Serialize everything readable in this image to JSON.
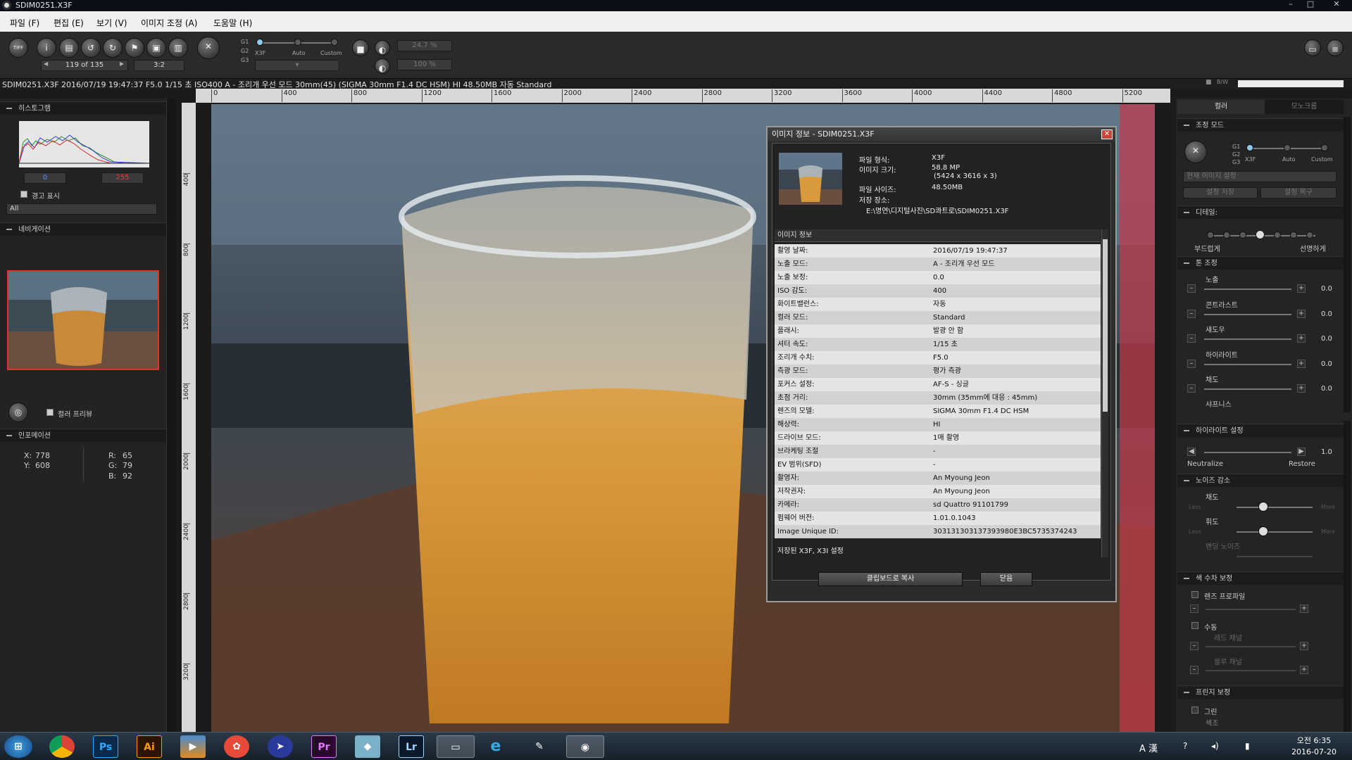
{
  "window": {
    "title": "SDIM0251.X3F",
    "minimize": "–",
    "maximize": "□",
    "close": "✕"
  },
  "menu": [
    "파일 (F)",
    "편집 (E)",
    "보기 (V)",
    "이미지 조정 (A)",
    "도움말 (H)"
  ],
  "toolbar": {
    "save_tiff_label": "TIFF",
    "frame_counter": "119 of 135",
    "ratio": "3:2",
    "mode_labels": [
      "G1",
      "G2",
      "G3"
    ],
    "mode_options": [
      "X3F",
      "Auto",
      "Custom"
    ],
    "zoom_primary": "24.7 %",
    "zoom_secondary": "100 %"
  },
  "infobar": "SDIM0251.X3F 2016/07/19 19:47:37 F5.0 1/15 초 ISO400 A - 조리개 우선 모드 30mm(45) (SIGMA 30mm F1.4 DC HSM) HI 48.50MB 자동 Standard",
  "infobar_right": "B/W",
  "left": {
    "histogram_title": "히스토그램",
    "hist_low": "0",
    "hist_high": "255",
    "warning_label": "경고 표시",
    "channel_select": "All",
    "nav_title": "네비게이션",
    "color_preview_label": "컬러 프리뷰",
    "info_title": "인포메이션",
    "x_label": "X:",
    "x_val": "778",
    "y_label": "Y:",
    "y_val": "608",
    "r_label": "R:",
    "r_val": "65",
    "g_label": "G:",
    "g_val": "79",
    "b_label": "B:",
    "b_val": "92"
  },
  "ruler": {
    "top": [
      "0",
      "400",
      "800",
      "1200",
      "1600",
      "2000",
      "2400",
      "2800",
      "3200",
      "3600",
      "4000",
      "4400",
      "4800",
      "5200"
    ],
    "left": [
      "400",
      "800",
      "1200",
      "1600",
      "2000",
      "2400",
      "2800",
      "3200"
    ]
  },
  "dialog": {
    "title": "이미지 정보 - SDIM0251.X3F",
    "close": "✕",
    "file_format_label": "파일 형식:",
    "file_format": "X3F",
    "image_size_label": "이미지 크기:",
    "image_size_mp": "58.8 MP",
    "image_size_dims": "(5424 x 3616 x 3)",
    "file_size_label": "파일 사이즈:",
    "file_size": "48.50MB",
    "location_label": "저장 장소:",
    "location": "E:\\명연\\디지털사진\\SD콰트로\\SDIM0251.X3F",
    "section_title": "이미지 정보",
    "rows": [
      {
        "k": "촬영 날짜:",
        "v": "2016/07/19 19:47:37"
      },
      {
        "k": "노출 모드:",
        "v": "A - 조리개 우선 모드"
      },
      {
        "k": "노출 보정:",
        "v": "0.0"
      },
      {
        "k": "ISO 감도:",
        "v": "400"
      },
      {
        "k": "화이트밸런스:",
        "v": "자동"
      },
      {
        "k": "컬러 모드:",
        "v": "Standard"
      },
      {
        "k": "플래시:",
        "v": "발광 안 함"
      },
      {
        "k": "셔터 속도:",
        "v": "1/15 초"
      },
      {
        "k": "조리개 수치:",
        "v": "F5.0"
      },
      {
        "k": "측광 모드:",
        "v": "평가 측광"
      },
      {
        "k": "포커스 설정:",
        "v": "AF-S - 싱글"
      },
      {
        "k": "초점 거리:",
        "v": "30mm (35mm에 대응 : 45mm)"
      },
      {
        "k": "렌즈의 모델:",
        "v": "SIGMA 30mm F1.4 DC HSM"
      },
      {
        "k": "해상력:",
        "v": "HI"
      },
      {
        "k": "드라이브 모드:",
        "v": "1매 촬영"
      },
      {
        "k": "브라케팅 조절",
        "v": "-"
      },
      {
        "k": "EV 범위(SFD)",
        "v": "-"
      },
      {
        "k": "촬영자:",
        "v": "An Myoung Jeon"
      },
      {
        "k": "저작권자:",
        "v": "An Myoung Jeon"
      },
      {
        "k": "카메라:",
        "v": "sd Quattro 91101799"
      },
      {
        "k": "펌웨어 버전:",
        "v": "1.01.0.1043"
      },
      {
        "k": "Image Unique ID:",
        "v": "303131303137393980E3BC5735374243"
      }
    ],
    "saved_settings": "저장된 X3F, X3I 설정",
    "copy_button": "클립보드로 복사",
    "close_button": "닫음"
  },
  "right": {
    "tab_color": "컬러",
    "tab_mono": "모노크롬",
    "adjust_mode_title": "조정 모드",
    "mode_labels": [
      "G1",
      "G2",
      "G3"
    ],
    "mode_options": [
      "X3F",
      "Auto",
      "Custom"
    ],
    "preset_select": "현재 이미지 설정",
    "save_settings_button": "설정 저장",
    "restore_button": "설정 복구",
    "detail_title": "디테일:",
    "detail_soft": "부드럽게",
    "detail_sharp": "선명하게",
    "tone_title": "톤 조정",
    "tone_items": [
      {
        "label": "노출",
        "value": "0.0"
      },
      {
        "label": "콘트라스트",
        "value": "0.0"
      },
      {
        "label": "섀도우",
        "value": "0.0"
      },
      {
        "label": "하이라이트",
        "value": "0.0"
      },
      {
        "label": "채도",
        "value": "0.0"
      },
      {
        "label": "샤프니스",
        "value": ""
      }
    ],
    "highlight_title": "하이라이트 설정",
    "highlight_value": "1.0",
    "neutralize": "Neutralize",
    "restore": "Restore",
    "noise_title": "노이즈 감소",
    "noise_items": [
      "채도",
      "휘도",
      "밴딩 노이즈"
    ],
    "less": "Less",
    "more": "More",
    "color_fix_title": "색 수차 보정",
    "lens_profile": "렌즈 프로파일",
    "manual": "수동",
    "red_channel": "레드 채널",
    "blue_channel": "블루 채널",
    "fringe_title": "프린지 보정",
    "green": "그린",
    "color_label": "색조"
  },
  "taskbar": {
    "apps": [
      "Ps",
      "Ai",
      "Pr",
      "Lr"
    ],
    "ime": "A 漢",
    "time": "오전 6:35",
    "date": "2016-07-20"
  }
}
